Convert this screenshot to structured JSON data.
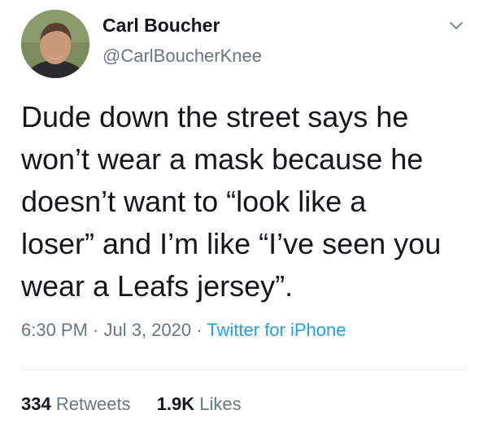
{
  "author": {
    "name": "Carl Boucher",
    "handle": "@CarlBoucherKnee"
  },
  "tweet": {
    "lines": [
      "Dude down the street says he",
      "won’t wear a mask because he",
      "doesn’t want to “look like a",
      "loser” and I’m like “I’ve seen you",
      "wear a Leafs jersey”."
    ]
  },
  "meta": {
    "time": "6:30 PM",
    "separator_1": " · ",
    "date": "Jul 3, 2020",
    "separator_2": " · ",
    "source": "Twitter for iPhone"
  },
  "stats": {
    "retweets_count": "334",
    "retweets_label": "Retweets",
    "likes_count": "1.9K",
    "likes_label": "Likes"
  },
  "icons": {
    "more_menu": "chevron-down-icon",
    "avatar": "profile-photo"
  },
  "colors": {
    "text": "#14171a",
    "secondary": "#657786",
    "link": "#1da1f2",
    "divider": "#e1e8ed"
  }
}
